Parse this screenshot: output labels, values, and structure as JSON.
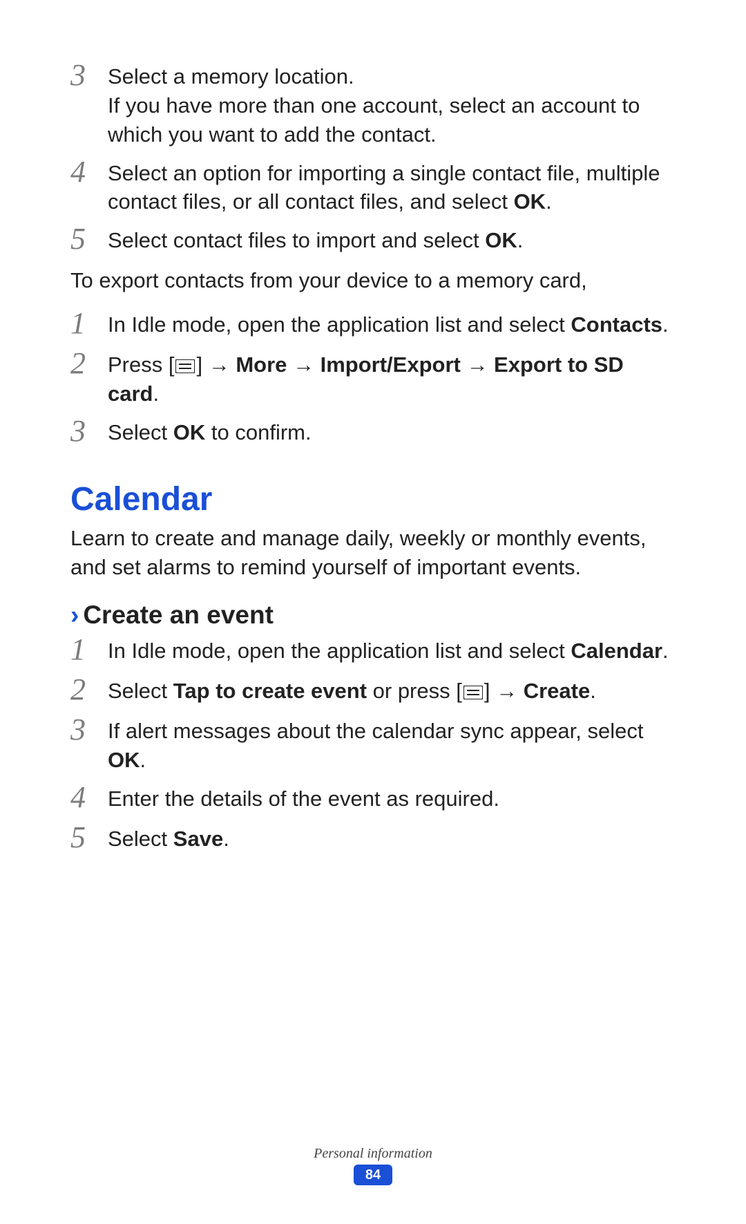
{
  "stepsA": {
    "3": {
      "num": "3",
      "line1": "Select a memory location.",
      "line2": "If you have more than one account, select an account to which you want to add the contact."
    },
    "4": {
      "num": "4",
      "pre": "Select an option for importing a single contact file, multiple contact files, or all contact files, and select ",
      "bold": "OK",
      "post": "."
    },
    "5": {
      "num": "5",
      "pre": "Select contact files to import and select ",
      "bold": "OK",
      "post": "."
    }
  },
  "exportIntro": "To export contacts from your device to a memory card,",
  "stepsB": {
    "1": {
      "num": "1",
      "pre": "In Idle mode, open the application list and select ",
      "bold": "Contacts",
      "post": "."
    },
    "2": {
      "num": "2",
      "pre": "Press [",
      "arrow": "] → ",
      "bold": "More → Import/Export → Export to SD card",
      "post": "."
    },
    "3": {
      "num": "3",
      "pre": "Select ",
      "bold": "OK",
      "post": " to confirm."
    }
  },
  "calendar": {
    "heading": "Calendar",
    "intro": "Learn to create and manage daily, weekly or monthly events, and set alarms to remind yourself of important events."
  },
  "createEvent": {
    "chev": "›",
    "heading": "Create an event",
    "1": {
      "num": "1",
      "pre": "In Idle mode, open the application list and select ",
      "bold": "Calendar",
      "post": "."
    },
    "2": {
      "num": "2",
      "pre": "Select ",
      "bold1": "Tap to create event",
      "mid": " or press [",
      "arrow": "] → ",
      "bold2": "Create",
      "post": "."
    },
    "3": {
      "num": "3",
      "pre": "If alert messages about the calendar sync appear, select ",
      "bold": "OK",
      "post": "."
    },
    "4": {
      "num": "4",
      "text": "Enter the details of the event as required."
    },
    "5": {
      "num": "5",
      "pre": "Select ",
      "bold": "Save",
      "post": "."
    }
  },
  "footer": {
    "section": "Personal information",
    "page": "84"
  }
}
